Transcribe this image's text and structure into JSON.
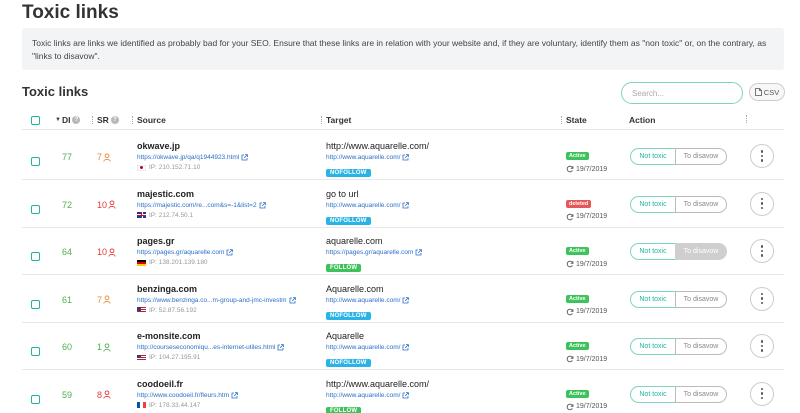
{
  "page": {
    "title": "Toxic links",
    "intro": "Toxic links are links we identified as probably bad for your SEO. Ensure that these links are in relation with your website and, if they are voluntary, identify them as \"non toxic\" or, on the contrary, as \"links to disavow\"."
  },
  "section": {
    "title": "Toxic links",
    "search_placeholder": "Search...",
    "csv_label": "CSV"
  },
  "columns": {
    "di": "DI",
    "sr": "SR",
    "source": "Source",
    "target": "Target",
    "state": "State",
    "action": "Action"
  },
  "actions": {
    "not_toxic": "Not toxic",
    "to_disavow": "To disavow"
  },
  "colors": {
    "accent": "#21b3a3",
    "di_green": "#4caf50",
    "sr_orange": "#e8893a",
    "sr_red": "#e53935",
    "sr_green": "#4caf50",
    "link_blue": "#2a6fc9",
    "nofollow": "#2ab4e6",
    "follow": "#3ec25b",
    "active": "#3ec25b",
    "deleted": "#e45858"
  },
  "rows": [
    {
      "di": "77",
      "sr": "7",
      "sr_color": "#e8893a",
      "domain": "okwave.jp",
      "url": "https://okwave.jp/qa/q1944923.html",
      "flag": "jp",
      "ip": "IP: 210.152.71.10",
      "target": "http://www.aquarelle.com/",
      "target_url": "http://www.aquarelle.com/",
      "rel": "NOFOLLOW",
      "state": "Active",
      "date": "19/7/2019",
      "disavow_active": false
    },
    {
      "di": "72",
      "sr": "10",
      "sr_color": "#e53935",
      "domain": "majestic.com",
      "url": "https://majestic.com/re...com&s=-1&list=2",
      "flag": "gb",
      "ip": "IP: 212.74.50.1",
      "target": "go to url",
      "target_url": "http://www.aquarelle.com/",
      "rel": "NOFOLLOW",
      "state": "deleted",
      "date": "19/7/2019",
      "disavow_active": false
    },
    {
      "di": "64",
      "sr": "10",
      "sr_color": "#e53935",
      "domain": "pages.gr",
      "url": "https://pages.gr/aquarelle.com",
      "flag": "de",
      "ip": "IP: 138.201.139.180",
      "target": "aquarelle.com",
      "target_url": "https://pages.gr/aquarelle.com",
      "rel": "FOLLOW",
      "state": "Active",
      "date": "19/7/2019",
      "disavow_active": true
    },
    {
      "di": "61",
      "sr": "7",
      "sr_color": "#e8893a",
      "domain": "benzinga.com",
      "url": "https://www.benzinga.co...m-group-and-jmc-investm",
      "flag": "us",
      "ip": "IP: 52.87.56.192",
      "target": "Aquarelle.com",
      "target_url": "http://www.aquarelle.com/",
      "rel": "NOFOLLOW",
      "state": "Active",
      "date": "19/7/2019",
      "disavow_active": false
    },
    {
      "di": "60",
      "sr": "1",
      "sr_color": "#4caf50",
      "domain": "e-monsite.com",
      "url": "http://courseseconomiqu...es-internet-utiles.html",
      "flag": "us",
      "ip": "IP: 104.27.195.91",
      "target": "Aquarelle",
      "target_url": "http://www.aquarelle.com/",
      "rel": "NOFOLLOW",
      "state": "Active",
      "date": "19/7/2019",
      "disavow_active": false
    },
    {
      "di": "59",
      "sr": "8",
      "sr_color": "#e53935",
      "domain": "coodoeil.fr",
      "url": "http://www.coodoeil.fr/fleurs.htm",
      "flag": "fr",
      "ip": "IP: 178.33.44.147",
      "target": "http://www.aquarelle.com/",
      "target_url": "http://www.aquarelle.com/",
      "rel": "FOLLOW",
      "state": "Active",
      "date": "19/7/2019",
      "disavow_active": false
    }
  ]
}
